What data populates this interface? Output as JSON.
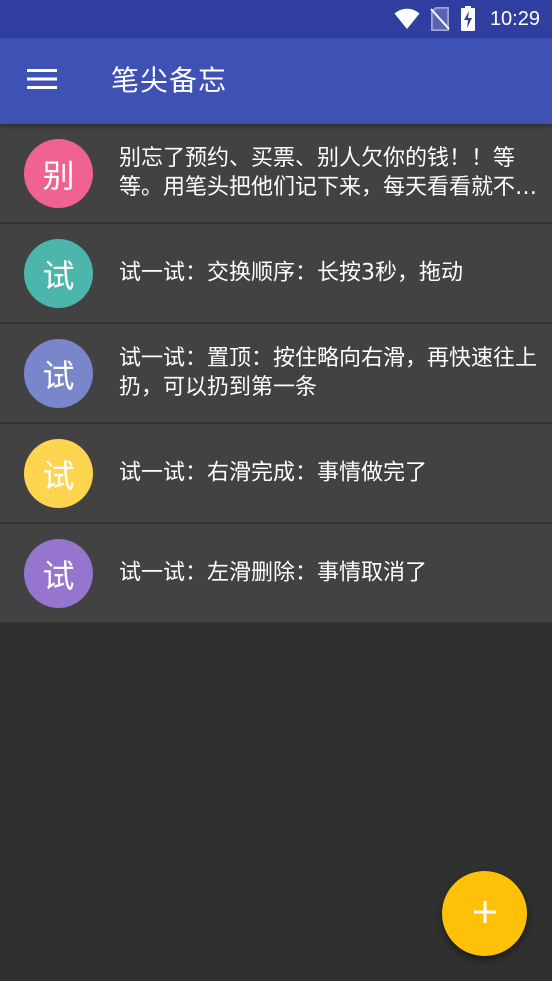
{
  "status_bar": {
    "time": "10:29",
    "icons": [
      "wifi-icon",
      "no-sim-icon",
      "battery-charging-icon"
    ]
  },
  "app_bar": {
    "menu_icon": "hamburger-menu-icon",
    "title": "笔尖备忘"
  },
  "colors": {
    "status_bar": "#303F9F",
    "app_bar": "#3F51B5",
    "background": "#303030",
    "list_item": "#424242",
    "fab": "#FFC107"
  },
  "memos": [
    {
      "avatar": "别",
      "avatar_color": "#F06292",
      "text": "别忘了预约、买票、别人欠你的钱！！等等。用笔头把他们记下来，每天看看就不会忘记了"
    },
    {
      "avatar": "试",
      "avatar_color": "#4DB6AC",
      "text": "试一试：交换顺序：长按3秒，拖动"
    },
    {
      "avatar": "试",
      "avatar_color": "#7986CB",
      "text": "试一试：置顶：按住略向右滑，再快速往上扔，可以扔到第一条"
    },
    {
      "avatar": "试",
      "avatar_color": "#FFD54F",
      "text": "试一试：右滑完成：事情做完了"
    },
    {
      "avatar": "试",
      "avatar_color": "#9575CD",
      "text": "试一试：左滑删除：事情取消了"
    }
  ],
  "fab": {
    "icon": "plus-icon",
    "label": "+"
  }
}
